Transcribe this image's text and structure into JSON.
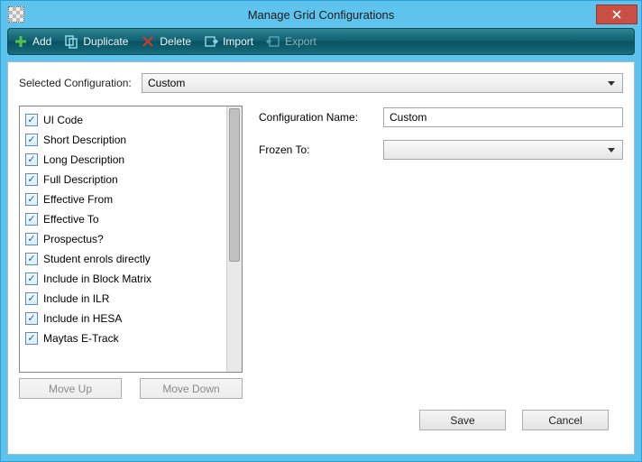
{
  "window": {
    "title": "Manage Grid Configurations"
  },
  "toolbar": {
    "add": "Add",
    "duplicate": "Duplicate",
    "delete": "Delete",
    "import": "Import",
    "export": "Export"
  },
  "selected": {
    "label": "Selected Configuration:",
    "value": "Custom"
  },
  "list": {
    "items": [
      {
        "label": "UI Code",
        "checked": true
      },
      {
        "label": "Short Description",
        "checked": true
      },
      {
        "label": "Long Description",
        "checked": true
      },
      {
        "label": "Full Description",
        "checked": true
      },
      {
        "label": "Effective From",
        "checked": true
      },
      {
        "label": "Effective To",
        "checked": true
      },
      {
        "label": "Prospectus?",
        "checked": true
      },
      {
        "label": "Student enrols directly",
        "checked": true
      },
      {
        "label": "Include in Block Matrix",
        "checked": true
      },
      {
        "label": "Include in ILR",
        "checked": true
      },
      {
        "label": "Include in HESA",
        "checked": true
      },
      {
        "label": "Maytas E-Track",
        "checked": true
      }
    ]
  },
  "buttons": {
    "moveUp": "Move Up",
    "moveDown": "Move Down",
    "save": "Save",
    "cancel": "Cancel"
  },
  "form": {
    "configNameLabel": "Configuration Name:",
    "configNameValue": "Custom",
    "frozenToLabel": "Frozen To:",
    "frozenToValue": ""
  }
}
